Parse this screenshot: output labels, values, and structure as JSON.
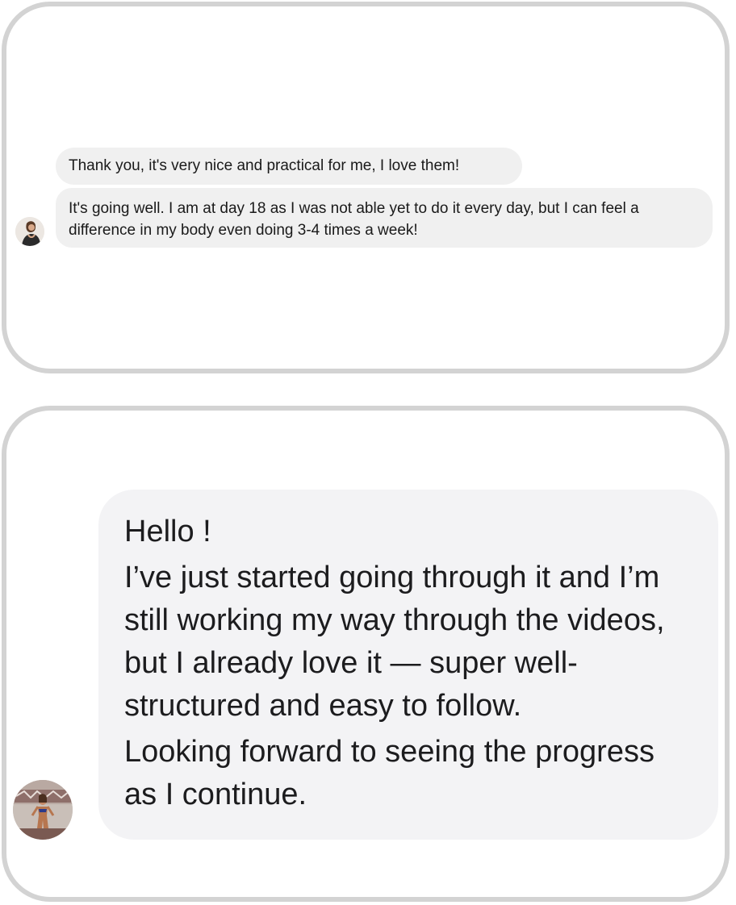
{
  "conversation_1": {
    "messages": [
      "Thank you, it's very nice and practical for me, I love them!",
      "It's going well. I am at day 18 as I was not able yet to do it every day, but I can feel a difference in my body even doing 3-4 times a week!"
    ]
  },
  "conversation_2": {
    "message_lines": [
      "Hello !",
      "I’ve just started going through it and I’m still working my way through the videos, but I already love it — super well-structured and easy to follow.",
      "Looking forward to seeing the progress as I continue."
    ]
  },
  "colors": {
    "card_border": "#d3d3d3",
    "bubble_bg": "#f0f0f0",
    "bubble_bg_large": "#f3f3f5"
  },
  "icons": {
    "avatar_1": "user-avatar-photo",
    "avatar_2": "user-avatar-photo"
  }
}
